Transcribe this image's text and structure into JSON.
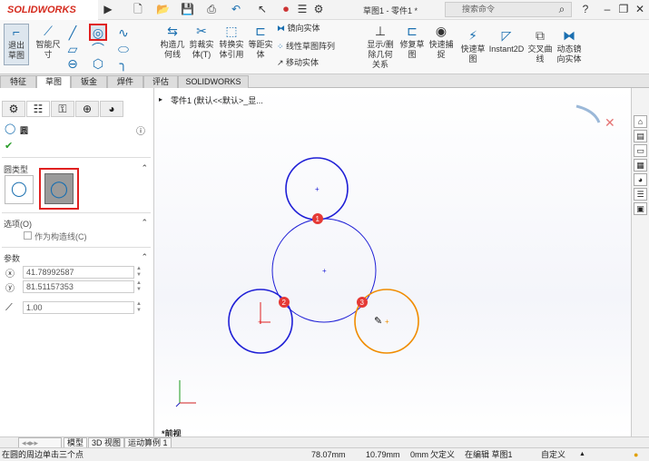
{
  "app": {
    "logo": "SOLIDWORKS",
    "title": "草图1 - 零件1 *",
    "search_placeholder": "搜索命令",
    "help": "?"
  },
  "ribbon": {
    "exit_sketch": "退出草图",
    "smart_dim": "智能尺寸",
    "construct_geom": "构造几何线",
    "trim": "剪裁实体(T)",
    "convert": "转换实体引用",
    "offset": "等距实体",
    "mirror": "镜向实体",
    "linear_pattern": "线性草图阵列",
    "move": "移动实体",
    "display_rel": "显示/删除几何关系",
    "repair": "修复草图",
    "quick_snap": "快速捕捉",
    "rapid_sketch": "快速草图",
    "instant2d": "Instant2D",
    "intersection": "交叉曲线",
    "dynamic_mirror": "动态镜向实体"
  },
  "tabs": [
    "特征",
    "草图",
    "钣金",
    "焊件",
    "评估",
    "SOLIDWORKS MBD"
  ],
  "active_tab": 1,
  "panel": {
    "title": "圆",
    "circle_type": "圆类型",
    "options": "选项(O)",
    "construction": "作为构造线(C)",
    "params": "参数",
    "x": "41.78992587",
    "y": "81.51157353",
    "r": "1.00"
  },
  "canvas": {
    "breadcrumb": "零件1 (默认<<默认>_显...",
    "view": "*前视",
    "badges": [
      "1",
      "2",
      "3"
    ],
    "colors": {
      "blue": "#1f1fd6",
      "orange": "#f08c00",
      "badge": "#e53935"
    }
  },
  "bottom_tabs": [
    "模型",
    "3D 视图",
    "运动算例 1"
  ],
  "status": {
    "hint": "在圆的周边单击三个点",
    "x": "78.07mm",
    "y": "10.79mm",
    "z": "0mm",
    "state": "欠定义",
    "editing": "在编辑 草图1",
    "custom": "自定义"
  }
}
